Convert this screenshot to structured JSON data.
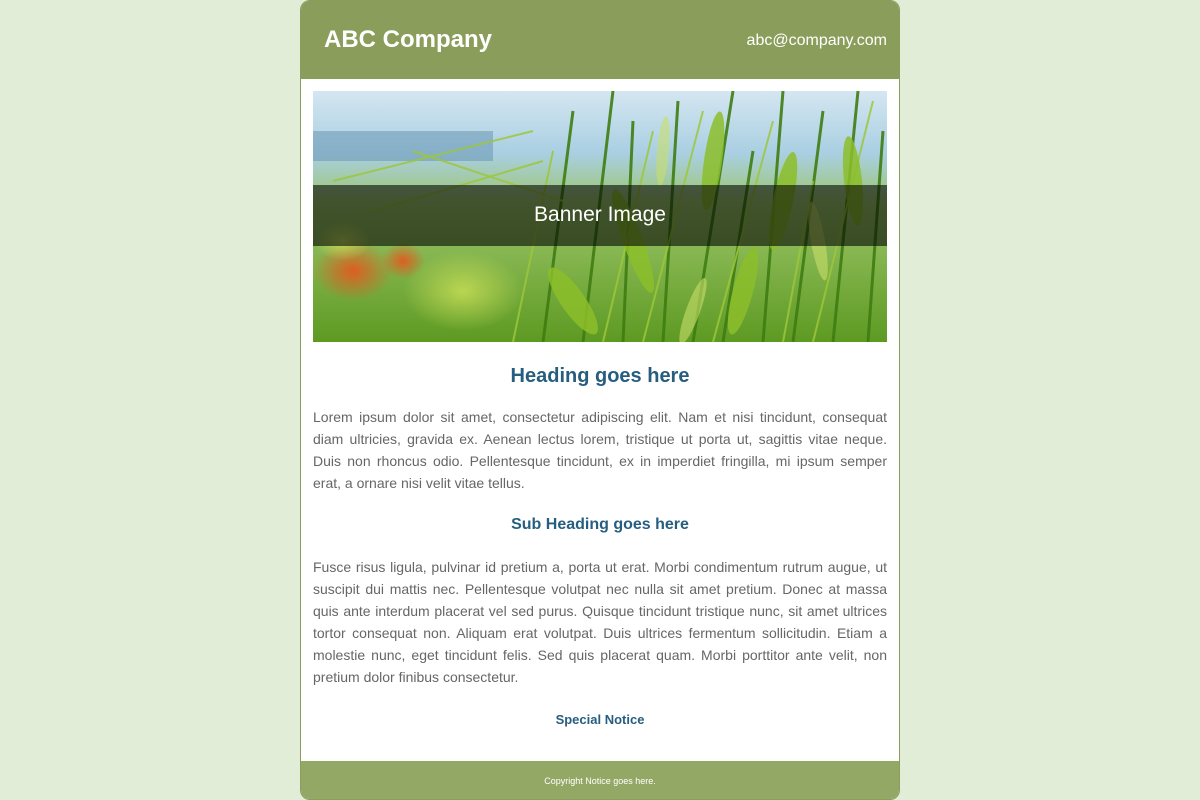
{
  "header": {
    "company_name": "ABC Company",
    "email": "abc@company.com"
  },
  "banner": {
    "label": "Banner Image"
  },
  "content": {
    "heading": "Heading goes here",
    "paragraph1": "Lorem ipsum dolor sit amet, consectetur adipiscing elit. Nam et nisi tincidunt, consequat diam ultricies, gravida ex. Aenean lectus lorem, tristique ut porta ut, sagittis vitae neque. Duis non rhoncus odio. Pellentesque tincidunt, ex in imperdiet fringilla, mi ipsum semper erat, a ornare nisi velit vitae tellus.",
    "subheading": "Sub Heading goes here",
    "paragraph2": "Fusce risus ligula, pulvinar id pretium a, porta ut erat. Morbi condimentum rutrum augue, ut suscipit dui mattis nec. Pellentesque volutpat nec nulla sit amet pretium. Donec at massa quis ante interdum placerat vel sed purus. Quisque tincidunt tristique nunc, sit amet ultrices tortor consequat non. Aliquam erat volutpat. Duis ultrices fermentum sollicitudin. Etiam a molestie nunc, eget tincidunt felis. Sed quis placerat quam. Morbi porttitor ante velit, non pretium dolor finibus consectetur.",
    "special_notice": "Special Notice"
  },
  "footer": {
    "copyright": "Copyright Notice goes here."
  },
  "colors": {
    "page_background": "#e1edd6",
    "header_background": "#8b9d5b",
    "footer_background": "#94a866",
    "heading_color": "#275e7f",
    "body_text": "#666666"
  }
}
